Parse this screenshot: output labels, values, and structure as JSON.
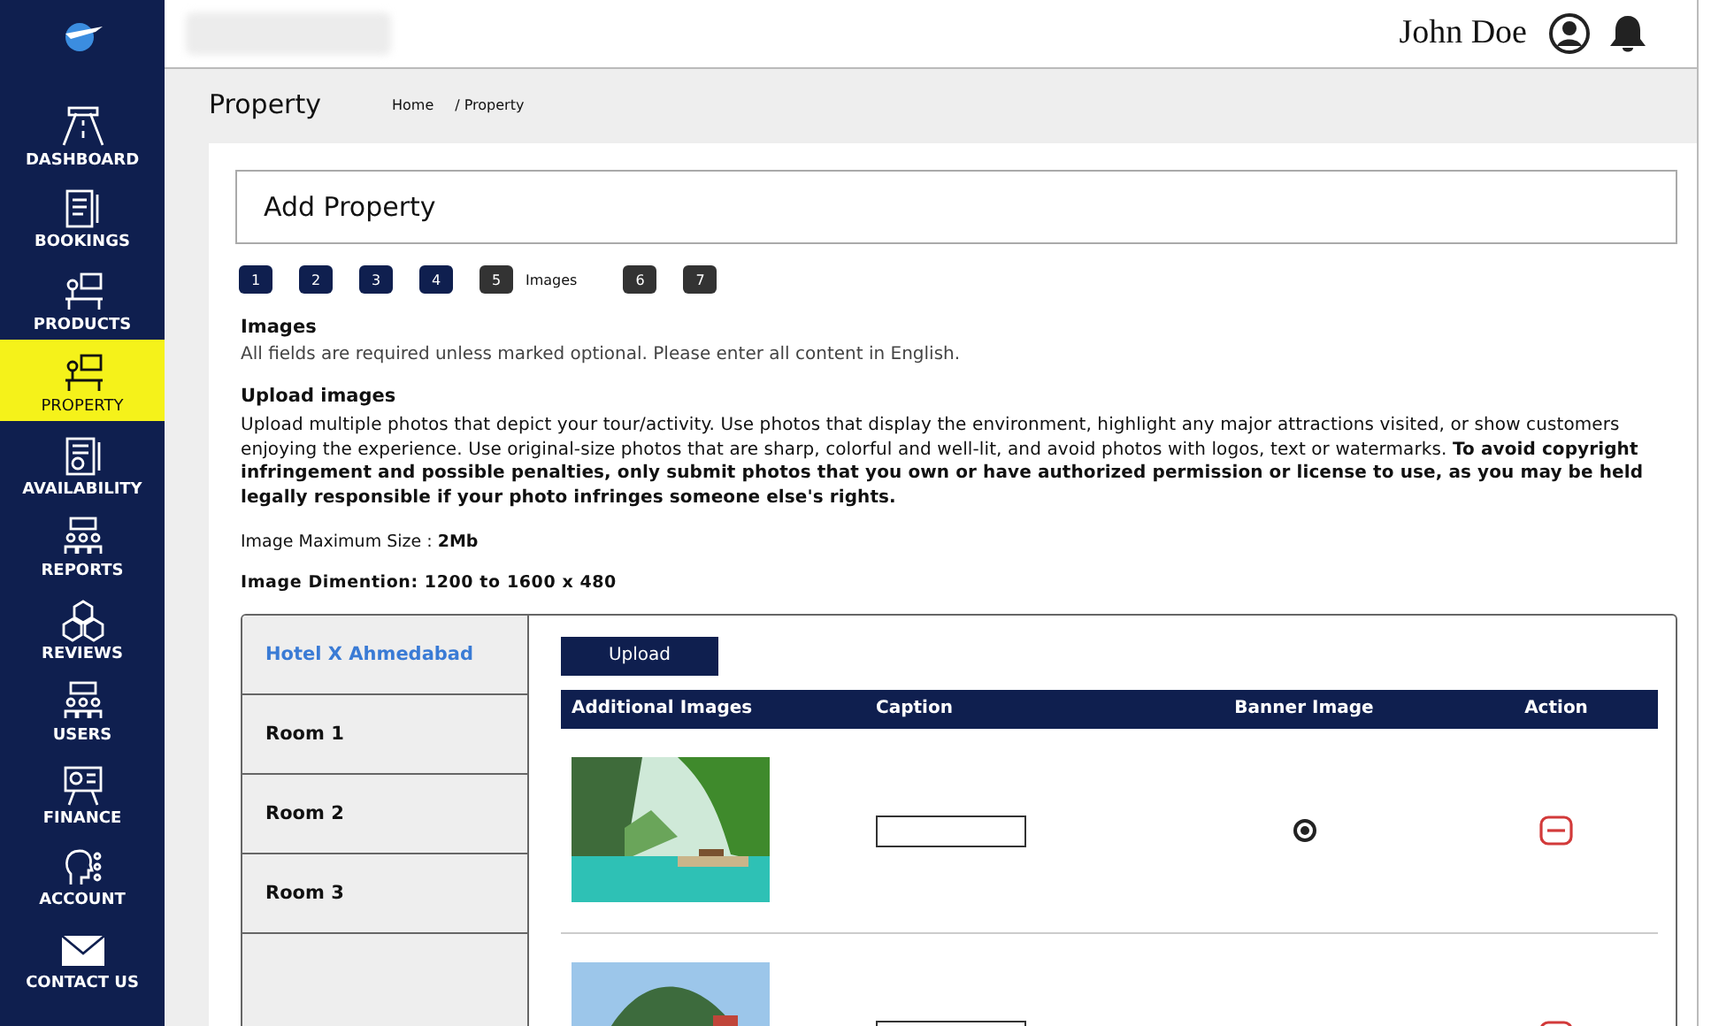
{
  "sidebar": {
    "items": [
      {
        "label": "DASHBOARD",
        "selected": false
      },
      {
        "label": "BOOKINGS",
        "selected": false
      },
      {
        "label": "PRODUCTS",
        "selected": false
      },
      {
        "label": "PROPERTY",
        "selected": true
      },
      {
        "label": "AVAILABILITY",
        "selected": false
      },
      {
        "label": "REPORTS",
        "selected": false
      },
      {
        "label": "REVIEWS",
        "selected": false
      },
      {
        "label": "USERS",
        "selected": false
      },
      {
        "label": "FINANCE",
        "selected": false
      },
      {
        "label": "ACCOUNT",
        "selected": false
      },
      {
        "label": "CONTACT US",
        "selected": false
      }
    ]
  },
  "topbar": {
    "user_name": "John Doe"
  },
  "page_title": "Property",
  "breadcrumbs": [
    "Home",
    "/ Property"
  ],
  "form_title": "Add Property",
  "steps": [
    {
      "number": "1",
      "done": true
    },
    {
      "number": "2",
      "done": true
    },
    {
      "number": "3",
      "done": true
    },
    {
      "number": "4",
      "done": true
    },
    {
      "number": "5",
      "done": false,
      "label": "Images"
    },
    {
      "number": "6",
      "done": false
    },
    {
      "number": "7",
      "done": false
    }
  ],
  "section_title": "Images",
  "section_note": "All fields are required unless marked optional. Please enter all content in English.",
  "upload_title": "Upload images",
  "upload_text": "Upload multiple photos that depict your tour/activity. Use photos that display the environment, highlight any major attractions visited, or show customers enjoying the experience. Use original-size photos that are sharp, colorful and well-lit, and avoid photos with logos, text or watermarks. **To avoid copyright infringement and possible penalties, only submit photos that you own or have authorized permission or license to use, as you may be held legally responsible if your photo infringes someone else's rights.**",
  "max_size": "Image Maximum Size : **2Mb**",
  "dimension": "Image Dimention: 1200 to 1600 x 480",
  "rooms": [
    {
      "label": "Hotel X Ahmedabad",
      "selected": true
    },
    {
      "label": "Room 1",
      "selected": false
    },
    {
      "label": "Room 2",
      "selected": false
    },
    {
      "label": "Room 3",
      "selected": false
    }
  ],
  "upload_button": "Upload",
  "table": {
    "columns": [
      "Additional Images",
      "Caption",
      "Banner Image",
      "Action"
    ],
    "rows": [
      {
        "image": {
          "kind": "picture"
        },
        "banner_selected": true
      },
      {
        "image": {
          "kind": "picture"
        }
      }
    ]
  }
}
